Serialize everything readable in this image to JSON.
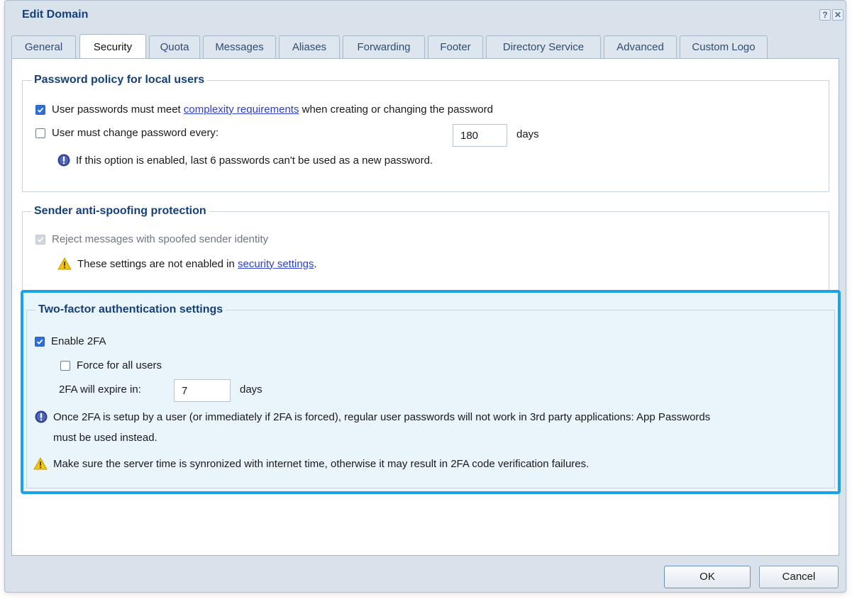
{
  "dialog": {
    "title": "Edit Domain",
    "help_label": "?",
    "close_label": "✕"
  },
  "tabs": [
    {
      "label": "General",
      "active": false
    },
    {
      "label": "Security",
      "active": true
    },
    {
      "label": "Quota",
      "active": false
    },
    {
      "label": "Messages",
      "active": false
    },
    {
      "label": "Aliases",
      "active": false
    },
    {
      "label": "Forwarding",
      "active": false
    },
    {
      "label": "Footer",
      "active": false
    },
    {
      "label": "Directory Service",
      "active": false
    },
    {
      "label": "Advanced",
      "active": false
    },
    {
      "label": "Custom Logo",
      "active": false
    }
  ],
  "password_policy": {
    "legend": "Password policy for local users",
    "complexity": {
      "checked": true,
      "text_before": "User passwords must meet ",
      "link": "complexity requirements",
      "text_after": " when creating or changing the password"
    },
    "change_every": {
      "checked": false,
      "label": "User must change password every:",
      "value": "180",
      "unit": "days"
    },
    "info": "If this option is enabled, last 6 passwords can't be used as a new password."
  },
  "anti_spoofing": {
    "legend": "Sender anti-spoofing protection",
    "reject": {
      "checked": true,
      "disabled": true,
      "label": "Reject messages with spoofed sender identity"
    },
    "warning_before": "These settings are not enabled in ",
    "warning_link": "security settings",
    "warning_after": "."
  },
  "two_factor": {
    "legend": "Two-factor authentication settings",
    "enable": {
      "checked": true,
      "label": "Enable 2FA"
    },
    "force": {
      "checked": false,
      "label": "Force for all users"
    },
    "expire_label": "2FA will expire in:",
    "expire_value": "7",
    "expire_unit": "days",
    "info_line1": "Once 2FA is setup by a user (or immediately if 2FA is forced), regular user passwords will not work in 3rd party applications: App Passwords",
    "info_line2": "must be used instead.",
    "warning": "Make sure the server time is synronized with internet time, otherwise it may result in 2FA code verification failures."
  },
  "buttons": {
    "ok": "OK",
    "cancel": "Cancel"
  },
  "colors": {
    "accent_highlight": "#1aa3e8",
    "checkbox_checked": "#2f6ed8",
    "legend": "#15407b",
    "link": "#2b3fd1",
    "info_icon": "#2e3f8f",
    "warning_icon": "#f1c40f"
  },
  "icons": {
    "info": "info-circle-icon",
    "warning": "warning-triangle-icon",
    "check": "checkmark-icon"
  }
}
